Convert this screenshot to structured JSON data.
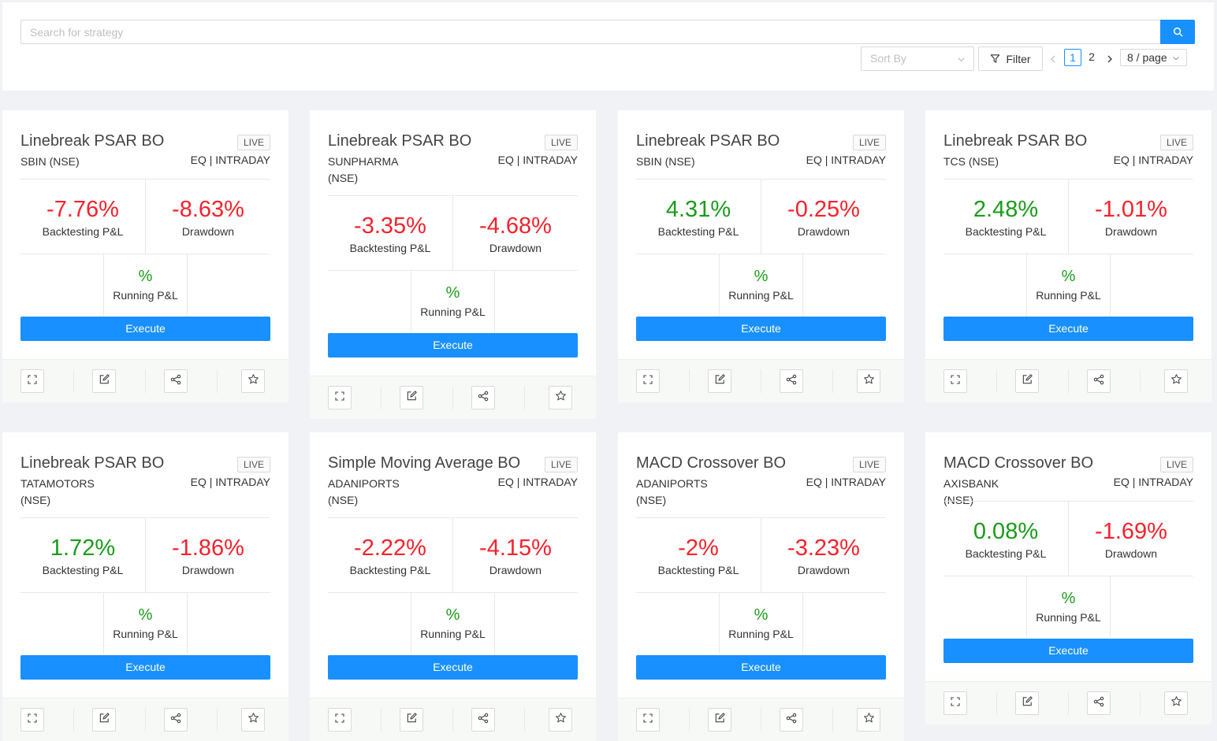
{
  "search": {
    "placeholder": "Search for strategy"
  },
  "toolbar": {
    "sort_placeholder": "Sort By",
    "filter_label": "Filter",
    "pages": [
      "1",
      "2"
    ],
    "current_page": "1",
    "page_size": "8 / page"
  },
  "common": {
    "backtesting_label": "Backtesting P&L",
    "drawdown_label": "Drawdown",
    "running_label": "Running P&L",
    "running_value": "%",
    "execute_label": "Execute",
    "live_label": "LIVE",
    "segment": "EQ | INTRADAY"
  },
  "colors": {
    "accent": "#1890ff",
    "negative": "#f5222d",
    "positive": "#1a9b1a"
  },
  "cards": [
    {
      "title": "Linebreak PSAR BO",
      "symbol": "SBIN (NSE)",
      "backtesting": "-7.76%",
      "drawdown": "-8.63%"
    },
    {
      "title": "Linebreak PSAR BO",
      "symbol": "SUNPHARMA (NSE)",
      "backtesting": "-3.35%",
      "drawdown": "-4.68%"
    },
    {
      "title": "Linebreak PSAR BO",
      "symbol": "SBIN (NSE)",
      "backtesting": "4.31%",
      "drawdown": "-0.25%"
    },
    {
      "title": "Linebreak PSAR BO",
      "symbol": "TCS (NSE)",
      "backtesting": "2.48%",
      "drawdown": "-1.01%"
    },
    {
      "title": "Linebreak PSAR BO",
      "symbol": "TATAMOTORS (NSE)",
      "backtesting": "1.72%",
      "drawdown": "-1.86%"
    },
    {
      "title": "Simple Moving Average BO",
      "symbol": "ADANIPORTS (NSE)",
      "backtesting": "-2.22%",
      "drawdown": "-4.15%"
    },
    {
      "title": "MACD Crossover BO",
      "symbol": "ADANIPORTS (NSE)",
      "backtesting": "-2%",
      "drawdown": "-3.23%"
    },
    {
      "title": "MACD Crossover BO",
      "symbol": "AXISBANK (NSE)",
      "backtesting": "0.08%",
      "drawdown": "-1.69%"
    }
  ]
}
